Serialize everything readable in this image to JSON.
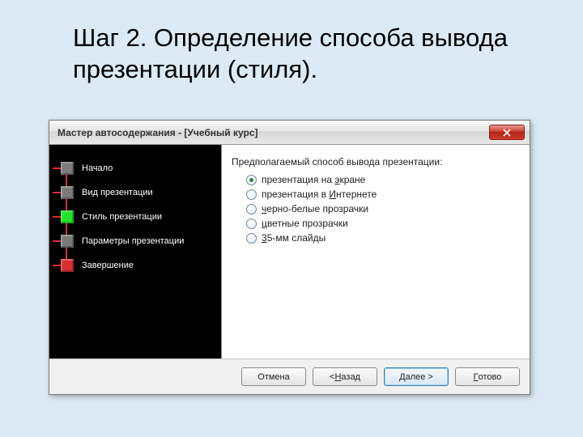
{
  "slide": {
    "title": "Шаг 2. Определение способа вывода презентации (стиля)."
  },
  "dialog": {
    "title": "Мастер автосодержания - [Учебный курс]",
    "close_glyph": "✕"
  },
  "wizard": {
    "steps": [
      {
        "label": "Начало",
        "color": "#7a7a7a"
      },
      {
        "label": "Вид презентации",
        "color": "#7a7a7a"
      },
      {
        "label": "Стиль презентации",
        "color": "#26e226"
      },
      {
        "label": "Параметры презентации",
        "color": "#7a7a7a"
      },
      {
        "label": "Завершение",
        "color": "#d72f2f"
      }
    ]
  },
  "options": {
    "heading": "Предполагаемый способ вывода презентации:",
    "items": [
      {
        "pre": "презентация на ",
        "u": "э",
        "post": "кране",
        "checked": true
      },
      {
        "pre": "презентация в ",
        "u": "И",
        "post": "нтернете",
        "checked": false
      },
      {
        "pre": "",
        "u": "ч",
        "post": "ерно-белые прозрачки",
        "checked": false
      },
      {
        "pre": "",
        "u": "ц",
        "post": "ветные прозрачки",
        "checked": false
      },
      {
        "pre": "",
        "u": "3",
        "post": "5-мм слайды",
        "checked": false
      }
    ]
  },
  "buttons": {
    "cancel": "Отмена",
    "back_pre": "< ",
    "back_u": "Н",
    "back_post": "азад",
    "next_pre": "",
    "next_u": "Д",
    "next_post": "алее >",
    "finish_pre": "",
    "finish_u": "Г",
    "finish_post": "отово"
  }
}
